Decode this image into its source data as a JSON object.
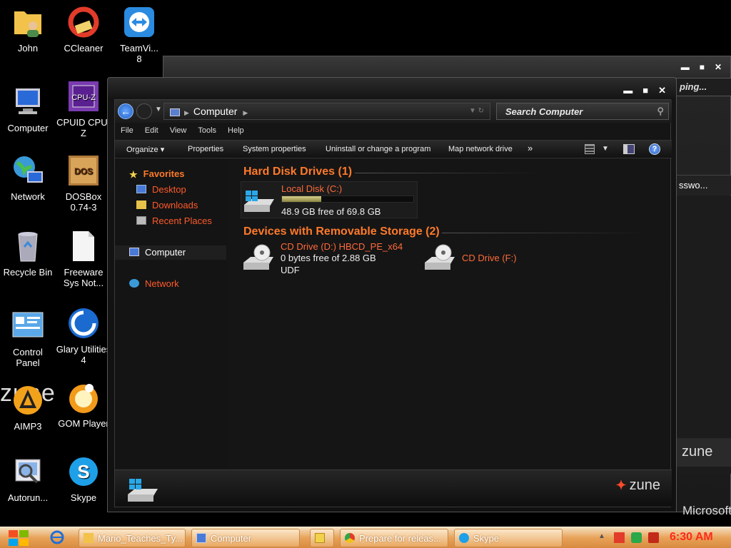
{
  "desktop": {
    "icons": [
      {
        "label": "John",
        "icon": "user-folder-icon"
      },
      {
        "label": "CCleaner",
        "icon": "ccleaner-icon"
      },
      {
        "label": "TeamVi...\n8",
        "icon": "teamviewer-icon"
      },
      {
        "label": "Computer",
        "icon": "computer-icon"
      },
      {
        "label": "CPUID CPU-Z",
        "icon": "cpuz-icon"
      },
      {
        "label": "Network",
        "icon": "network-globe-icon"
      },
      {
        "label": "DOSBox 0.74-3",
        "icon": "dosbox-icon"
      },
      {
        "label": "Recycle Bin",
        "icon": "recycle-bin-icon"
      },
      {
        "label": "Freeware Sys Not...",
        "icon": "document-icon"
      },
      {
        "label": "Control Panel",
        "icon": "control-panel-icon"
      },
      {
        "label": "Glary Utilities 4",
        "icon": "glary-icon"
      },
      {
        "label": "AIMP3",
        "icon": "aimp-icon"
      },
      {
        "label": "GOM Player",
        "icon": "gom-player-icon"
      },
      {
        "label": "Autorun...",
        "icon": "autorun-icon"
      },
      {
        "label": "Skype",
        "icon": "skype-icon"
      }
    ],
    "zune_watermark": "zune",
    "microsoft_fragment": "Microsoft"
  },
  "bg_window": {
    "search_fragment": "ping...",
    "bar_fragment": "sswo...",
    "zune_text": "zune",
    "btn_minimize": "▬",
    "btn_maximize": "■",
    "btn_close": "✕"
  },
  "window": {
    "btn_minimize": "▬",
    "btn_maximize": "■",
    "btn_close": "✕",
    "address": "Computer",
    "search_placeholder": "Search Computer",
    "menu": [
      "File",
      "Edit",
      "View",
      "Tools",
      "Help"
    ],
    "toolbar": {
      "organize": "Organize ▾",
      "properties": "Properties",
      "system_properties": "System properties",
      "uninstall": "Uninstall or change a program",
      "map_drive": "Map network drive",
      "more": "»"
    },
    "nav": {
      "favorites": "Favorites",
      "desktop": "Desktop",
      "downloads": "Downloads",
      "recent_places": "Recent Places",
      "computer": "Computer",
      "network": "Network"
    },
    "groups": {
      "hdd": "Hard Disk Drives (1)",
      "removable": "Devices with Removable Storage (2)"
    },
    "drives": {
      "c": {
        "name": "Local Disk (C:)",
        "free": "48.9 GB free of 69.8 GB",
        "used_fraction": 0.3
      },
      "d": {
        "name": "CD Drive (D:) HBCD_PE_x64",
        "free": "0 bytes free of 2.88 GB",
        "fs": "UDF"
      },
      "f": {
        "name": "CD Drive (F:)"
      }
    },
    "zune_brand": "zune"
  },
  "taskbar": {
    "items": [
      {
        "label": "Mario_Teaches_Ty...",
        "icon": "folder-icon"
      },
      {
        "label": "Computer",
        "icon": "computer-icon"
      },
      {
        "label": "",
        "icon": "media-icon"
      },
      {
        "label": "Prepare for releas...",
        "icon": "chrome-icon"
      },
      {
        "label": "Skype",
        "icon": "skype-icon"
      }
    ],
    "clock": "6:30 AM"
  },
  "colors": {
    "accent_orange": "#ff7a2a",
    "drive_name": "#ff6a3a",
    "clock": "#ff2a1a",
    "taskbar": "#e8a35a"
  }
}
